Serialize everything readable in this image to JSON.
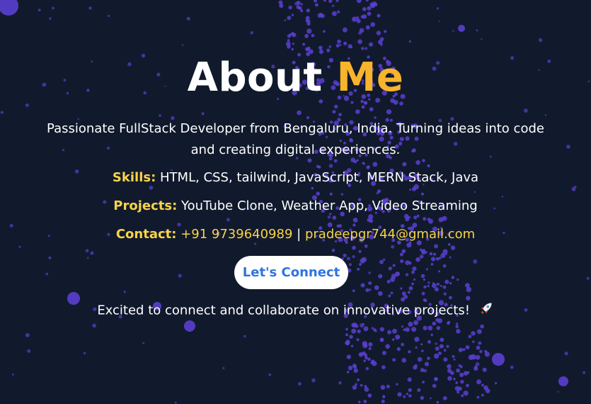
{
  "title": {
    "main": "About",
    "accent": "Me"
  },
  "intro": "Passionate FullStack Developer from Bengaluru, India. Turning ideas into code and creating digital experiences.",
  "skills": {
    "label": "Skills:",
    "value": "HTML, CSS, tailwind, JavaScript, MERN Stack, Java"
  },
  "projects": {
    "label": "Projects:",
    "value": "YouTube Clone, Weather App, Video Streaming"
  },
  "contact": {
    "label": "Contact:",
    "phone": "+91 9739640989",
    "separator": "|",
    "email": "pradeepgr744@gmail.com"
  },
  "cta": {
    "label": "Let's Connect"
  },
  "tagline": "Excited to connect and collaborate on innovative projects!",
  "icons": {
    "rocket": "rocket-icon"
  },
  "colors": {
    "background": "#111a2c",
    "accent": "#f8b42b",
    "label": "#f8d34a",
    "particle": "#5b3fd1",
    "button_text": "#2f74e0"
  }
}
